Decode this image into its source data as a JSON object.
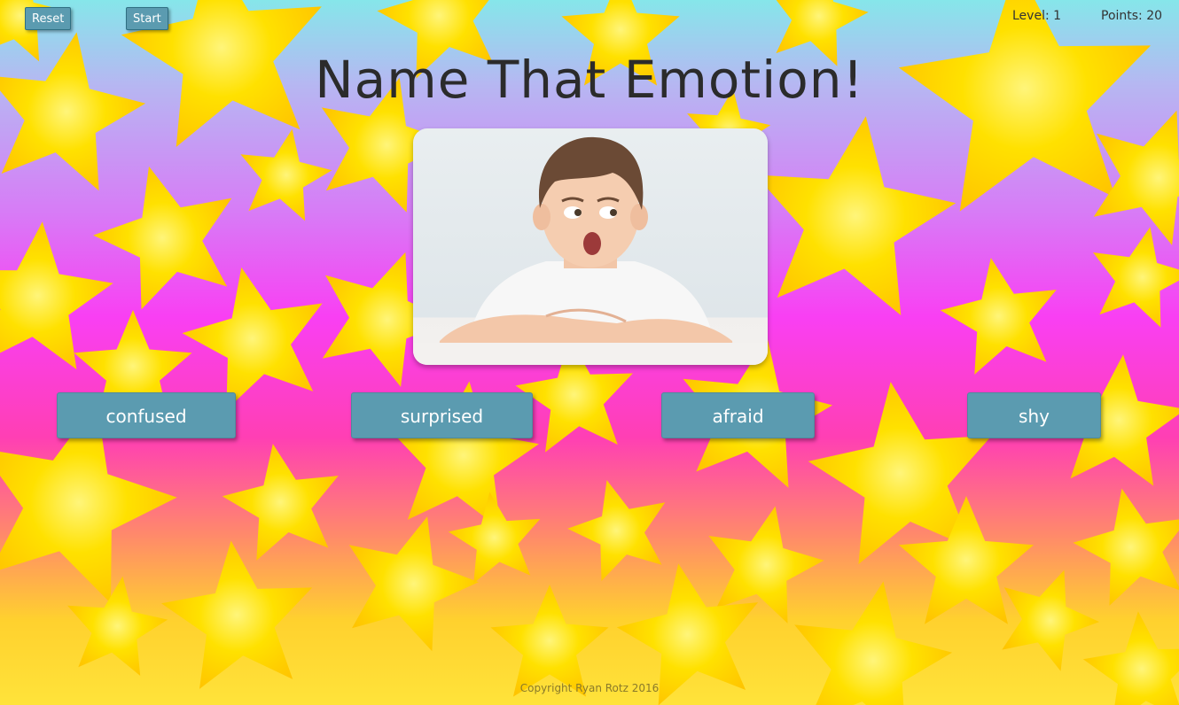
{
  "controls": {
    "reset_label": "Reset",
    "start_label": "Start"
  },
  "status": {
    "level": "Level: 1",
    "points": "Points: 20"
  },
  "title": "Name That Emotion!",
  "answers": [
    "confused",
    "surprised",
    "afraid",
    "shy"
  ],
  "footer": "Copyright Ryan Rotz 2016",
  "colors": {
    "button": "#5b9bb0",
    "star": "#ffd400",
    "title_text": "#2b2b2b"
  }
}
